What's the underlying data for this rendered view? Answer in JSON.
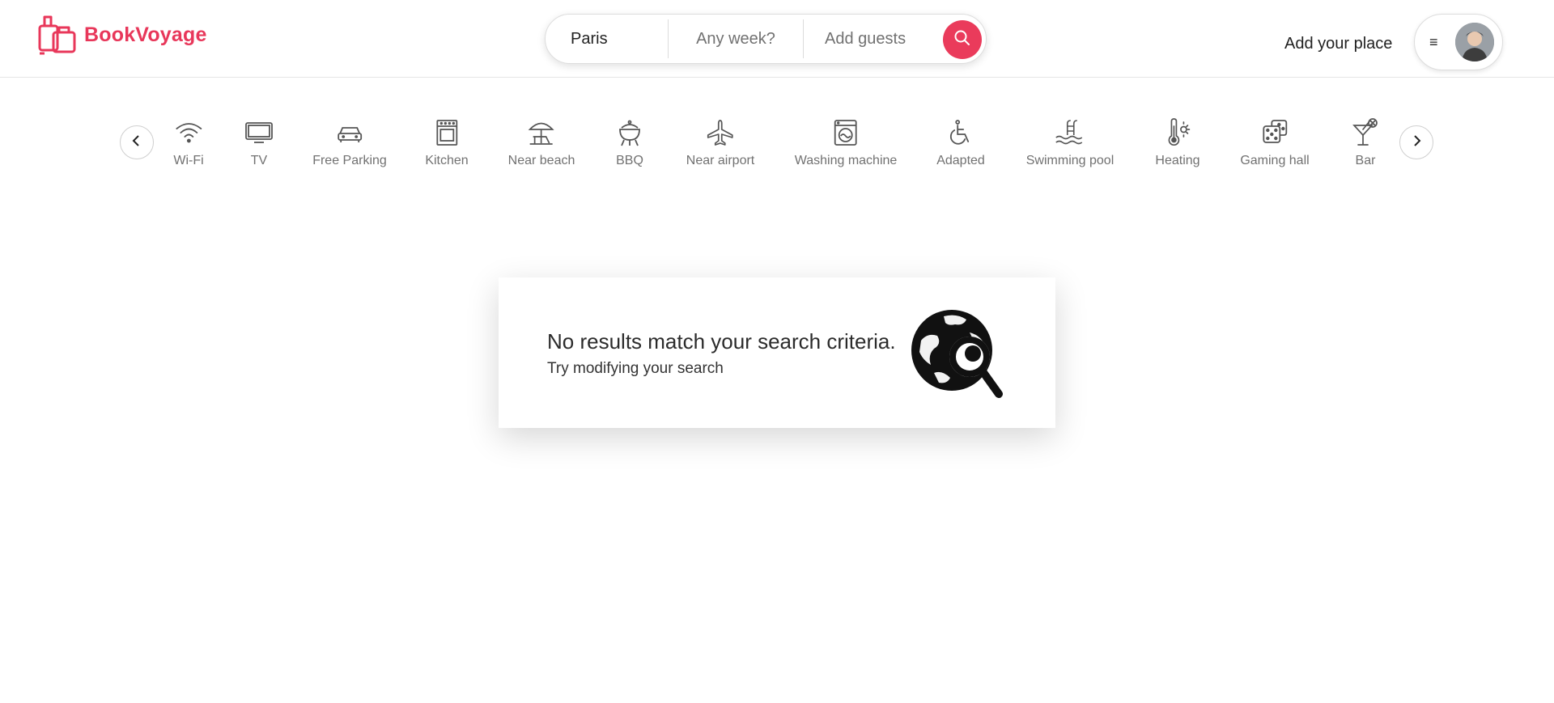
{
  "brand": {
    "name": "BookVoyage",
    "color": "#e8375a",
    "icon": "luggage-icon"
  },
  "search": {
    "where_value": "Paris",
    "when_placeholder": "Any week?",
    "who_placeholder": "Add guests",
    "button_icon": "search-icon",
    "button_color": "#ea3b5b"
  },
  "header": {
    "add_place_label": "Add your place",
    "menu_icon": "hamburger-icon",
    "avatar_icon": "user-avatar"
  },
  "categories": {
    "prev_icon": "chevron-left-icon",
    "next_icon": "chevron-right-icon",
    "items": [
      {
        "label": "Wi-Fi",
        "icon": "wifi-icon"
      },
      {
        "label": "TV",
        "icon": "tv-icon"
      },
      {
        "label": "Free Parking",
        "icon": "car-icon"
      },
      {
        "label": "Kitchen",
        "icon": "oven-icon"
      },
      {
        "label": "Near beach",
        "icon": "beach-umbrella-icon"
      },
      {
        "label": "BBQ",
        "icon": "grill-icon"
      },
      {
        "label": "Near airport",
        "icon": "airplane-icon"
      },
      {
        "label": "Washing machine",
        "icon": "washing-machine-icon"
      },
      {
        "label": "Adapted",
        "icon": "wheelchair-icon"
      },
      {
        "label": "Swimming pool",
        "icon": "pool-icon"
      },
      {
        "label": "Heating",
        "icon": "thermometer-icon"
      },
      {
        "label": "Gaming hall",
        "icon": "dice-icon"
      },
      {
        "label": "Bar",
        "icon": "cocktail-icon"
      }
    ]
  },
  "empty_state": {
    "title": "No results match your search criteria.",
    "subtitle": "Try modifying your search",
    "icon": "globe-search-icon"
  }
}
